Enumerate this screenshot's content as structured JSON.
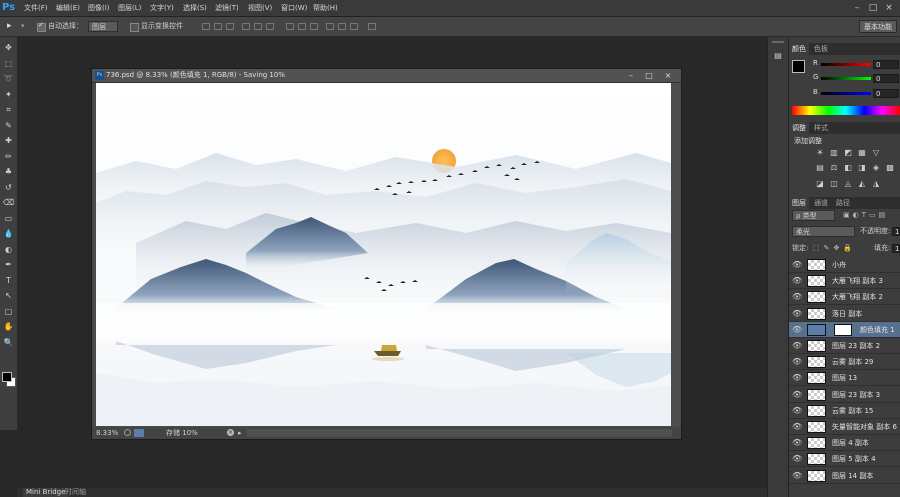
{
  "app": {
    "logo": "Ps"
  },
  "menu": [
    "文件(F)",
    "编辑(E)",
    "图像(I)",
    "图层(L)",
    "文字(Y)",
    "选择(S)",
    "滤镜(T)",
    "视图(V)",
    "窗口(W)",
    "帮助(H)"
  ],
  "window_controls": {
    "minimize": "–",
    "restore": "□",
    "close": "×"
  },
  "options": {
    "tool_glyph": "▸",
    "auto_select_label": "自动选择：",
    "auto_select_value": "图层",
    "show_transform_label": "显示变换控件"
  },
  "workspace_button": "基本功能",
  "toolbar_icons": [
    "move-icon",
    "marquee-icon",
    "lasso-icon",
    "quick-select-icon",
    "crop-icon",
    "eyedropper-icon",
    "healing-brush-icon",
    "brush-icon",
    "clone-stamp-icon",
    "history-brush-icon",
    "eraser-icon",
    "gradient-icon",
    "blur-icon",
    "dodge-icon",
    "pen-icon",
    "type-icon",
    "path-select-icon",
    "rectangle-icon",
    "hand-icon",
    "zoom-icon"
  ],
  "toolbar_glyphs": [
    "✥",
    "⬚",
    "➰",
    "✦",
    "⌗",
    "✎",
    "✚",
    "✏",
    "♣",
    "↺",
    "⌫",
    "▭",
    "💧",
    "◐",
    "✒",
    "T",
    "↖",
    "▢",
    "✋",
    "🔍"
  ],
  "document": {
    "title": "736.psd @ 8.33% (颜色填充 1, RGB/8) - Saving 10%",
    "ps_badge": "Ps",
    "zoom": "8.33%",
    "status": "存储 10%"
  },
  "color_panel": {
    "tabs": [
      "颜色",
      "色板"
    ],
    "channels": [
      {
        "label": "R",
        "value": "0",
        "color": "#e23b3b"
      },
      {
        "label": "G",
        "value": "0",
        "color": "#3bbf3b"
      },
      {
        "label": "B",
        "value": "0",
        "color": "#3b5be2"
      }
    ]
  },
  "adjust_panel": {
    "tabs": [
      "调整",
      "样式"
    ],
    "add_label": "添加调整",
    "icons_row1": [
      "☀",
      "▥",
      "◩",
      "▦",
      "▽"
    ],
    "icons_row2": [
      "▤",
      "⚖",
      "◧",
      "◨",
      "◈",
      "▩"
    ],
    "icons_row3": [
      "◪",
      "◫",
      "◬",
      "◭",
      "◮"
    ]
  },
  "layers_panel": {
    "tabs": [
      "图层",
      "通道",
      "路径"
    ],
    "filter_value": "ρ 类型",
    "blend_mode": "柔光",
    "opacity_label": "不透明度:",
    "opacity_value": "10",
    "lock_label": "锁定:",
    "fill_label": "填充:",
    "fill_value": "10",
    "layers": [
      {
        "name": "小舟",
        "selected": false
      },
      {
        "name": "大雁飞翔 副本 3",
        "selected": false
      },
      {
        "name": "大雁飞翔 副本 2",
        "selected": false
      },
      {
        "name": "落日 副本",
        "selected": false
      },
      {
        "name": "颜色填充 1",
        "selected": true
      },
      {
        "name": "图层 23 副本 2",
        "selected": false
      },
      {
        "name": "云雾 副本 29",
        "selected": false
      },
      {
        "name": "图层 13",
        "selected": false
      },
      {
        "name": "图层 23 副本 3",
        "selected": false
      },
      {
        "name": "云雾 副本 15",
        "selected": false
      },
      {
        "name": "矢量智能对象 副本 6",
        "selected": false
      },
      {
        "name": "图层 4 副本",
        "selected": false
      },
      {
        "name": "图层 5 副本 4",
        "selected": false
      },
      {
        "name": "图层 14 副本",
        "selected": false
      }
    ]
  },
  "bottom_tabs": [
    "Mini Bridge",
    "时间轴"
  ],
  "colors": {
    "accent": "#2fa3ff",
    "selected_layer": "#56708e",
    "sun": "#f5a623"
  }
}
